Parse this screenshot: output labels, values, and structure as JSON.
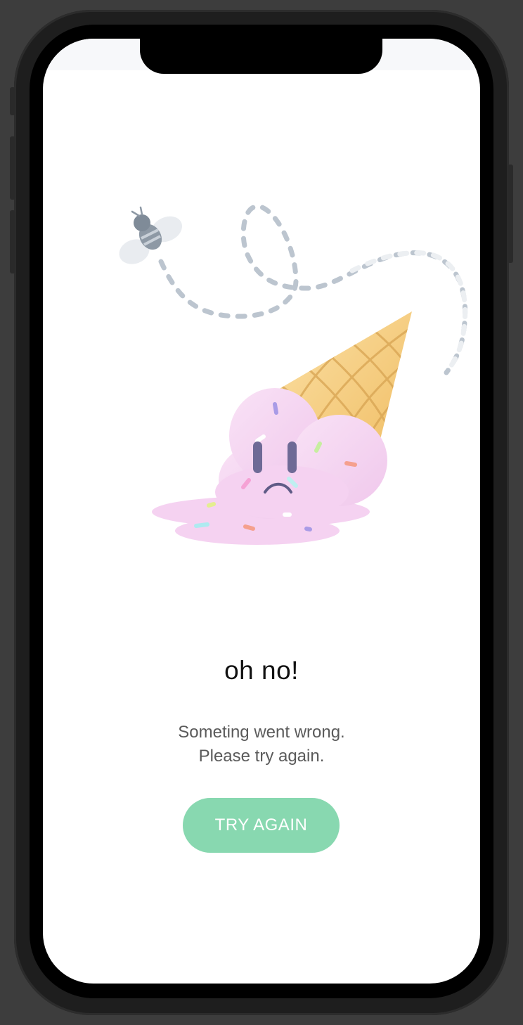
{
  "screen": {
    "title": "oh no!",
    "message_line1": "Someting went wrong.",
    "message_line2": "Please try again.",
    "button_label": "TRY AGAIN"
  },
  "colors": {
    "button": "#88d8b0",
    "ice_cream": "#f6d4f2",
    "cone": "#f2c36a",
    "bee": "#8a96a3",
    "trail": "#b9c2cc"
  },
  "illustration": {
    "icons": [
      "bee-icon",
      "flight-trail",
      "ice-cream-cone",
      "sad-face",
      "sprinkles"
    ]
  }
}
